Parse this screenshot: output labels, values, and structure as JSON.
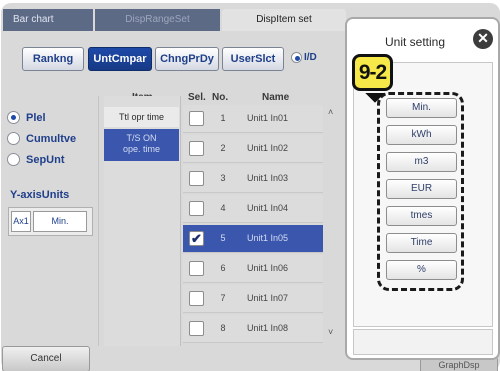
{
  "tabs": [
    {
      "label": "Bar chart"
    },
    {
      "label": "DispRangeSet"
    },
    {
      "label": "DispItem set"
    }
  ],
  "modes": [
    {
      "label": "Rankng",
      "selected": false
    },
    {
      "label": "UntCmpar",
      "selected": true
    },
    {
      "label": "ChngPrDy",
      "selected": false
    },
    {
      "label": "UserSlct",
      "selected": false
    }
  ],
  "io_radio": {
    "label": "I/D"
  },
  "left_panel": {
    "radios": [
      {
        "label": "Plel",
        "checked": true
      },
      {
        "label": "Cumultve",
        "checked": false
      },
      {
        "label": "SepUnt",
        "checked": false
      }
    ],
    "yaxis_title": "Y-axisUnits",
    "axis_label": "Ax1",
    "axis_value": "Min."
  },
  "table": {
    "headers": {
      "item": "Item",
      "sel": "Sel.",
      "no": "No.",
      "name": "Name"
    },
    "items": [
      {
        "label": "Ttl opr time",
        "selected": false
      },
      {
        "label": "T/S ON\nope. time",
        "selected": true
      }
    ],
    "rows": [
      {
        "no": "1",
        "name": "Unit1 In01",
        "checked": false,
        "selected": false
      },
      {
        "no": "2",
        "name": "Unit1 In02",
        "checked": false,
        "selected": false
      },
      {
        "no": "3",
        "name": "Unit1 In03",
        "checked": false,
        "selected": false
      },
      {
        "no": "4",
        "name": "Unit1 In04",
        "checked": false,
        "selected": false
      },
      {
        "no": "5",
        "name": "Unit1 In05",
        "checked": true,
        "selected": true
      },
      {
        "no": "6",
        "name": "Unit1 In06",
        "checked": false,
        "selected": false
      },
      {
        "no": "7",
        "name": "Unit1 In07",
        "checked": false,
        "selected": false
      },
      {
        "no": "8",
        "name": "Unit1 In08",
        "checked": false,
        "selected": false
      }
    ]
  },
  "bottom": {
    "cancel_label": "Cancel",
    "graph_label": "GraphDsp"
  },
  "popup": {
    "title": "Unit setting",
    "close_icon": "close-icon",
    "units": [
      "Min.",
      "kWh",
      "m3",
      "EUR",
      "tmes",
      "Time",
      "%"
    ]
  },
  "badge": {
    "label": "9-2"
  },
  "colors": {
    "accent": "#1e4aa8",
    "selected_row": "#3a57ad",
    "tab_bar": "#5d6a86",
    "badge": "#f7e84a"
  }
}
